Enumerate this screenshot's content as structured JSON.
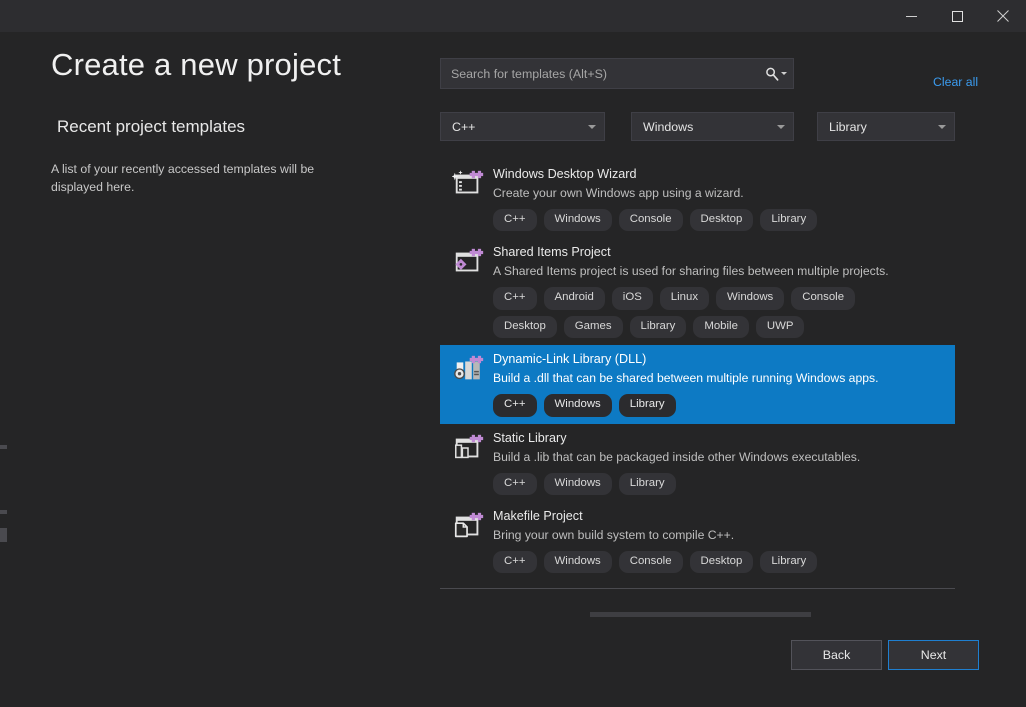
{
  "window": {
    "minimize_label": "Minimize",
    "maximize_label": "Maximize",
    "close_label": "Close"
  },
  "left": {
    "page_title": "Create a new project",
    "recent_heading": "Recent project templates",
    "recent_empty": "A list of your recently accessed templates will be displayed here."
  },
  "search": {
    "placeholder": "Search for templates (Alt+S)",
    "value": "",
    "icon": "search-icon",
    "clear_all_label": "Clear all"
  },
  "filters": [
    {
      "id": "language",
      "value": "C++"
    },
    {
      "id": "platform",
      "value": "Windows"
    },
    {
      "id": "type",
      "value": "Library"
    }
  ],
  "templates": [
    {
      "name": "Windows Desktop Wizard",
      "description": "Create your own Windows app using a wizard.",
      "tags": [
        "C++",
        "Windows",
        "Console",
        "Desktop",
        "Library"
      ],
      "selected": false,
      "icon": "window-wizard-icon"
    },
    {
      "name": "Shared Items Project",
      "description": "A Shared Items project is used for sharing files between multiple projects.",
      "tags": [
        "C++",
        "Android",
        "iOS",
        "Linux",
        "Windows",
        "Console",
        "Desktop",
        "Games",
        "Library",
        "Mobile",
        "UWP"
      ],
      "selected": false,
      "icon": "shared-items-icon"
    },
    {
      "name": "Dynamic-Link Library (DLL)",
      "description": "Build a .dll that can be shared between multiple running Windows apps.",
      "tags": [
        "C++",
        "Windows",
        "Library"
      ],
      "selected": true,
      "icon": "dll-icon"
    },
    {
      "name": "Static Library",
      "description": "Build a .lib that can be packaged inside other Windows executables.",
      "tags": [
        "C++",
        "Windows",
        "Library"
      ],
      "selected": false,
      "icon": "static-library-icon"
    },
    {
      "name": "Makefile Project",
      "description": "Bring your own build system to compile C++.",
      "tags": [
        "C++",
        "Windows",
        "Console",
        "Desktop",
        "Library"
      ],
      "selected": false,
      "icon": "makefile-icon"
    }
  ],
  "footer": {
    "back_label": "Back",
    "next_label": "Next"
  },
  "colors": {
    "accent": "#0d7ac4",
    "link": "#3b9cf0",
    "background": "#252526",
    "titlebar": "#2d2d30",
    "control": "#333337",
    "badge_purple": "#c08ad4"
  }
}
